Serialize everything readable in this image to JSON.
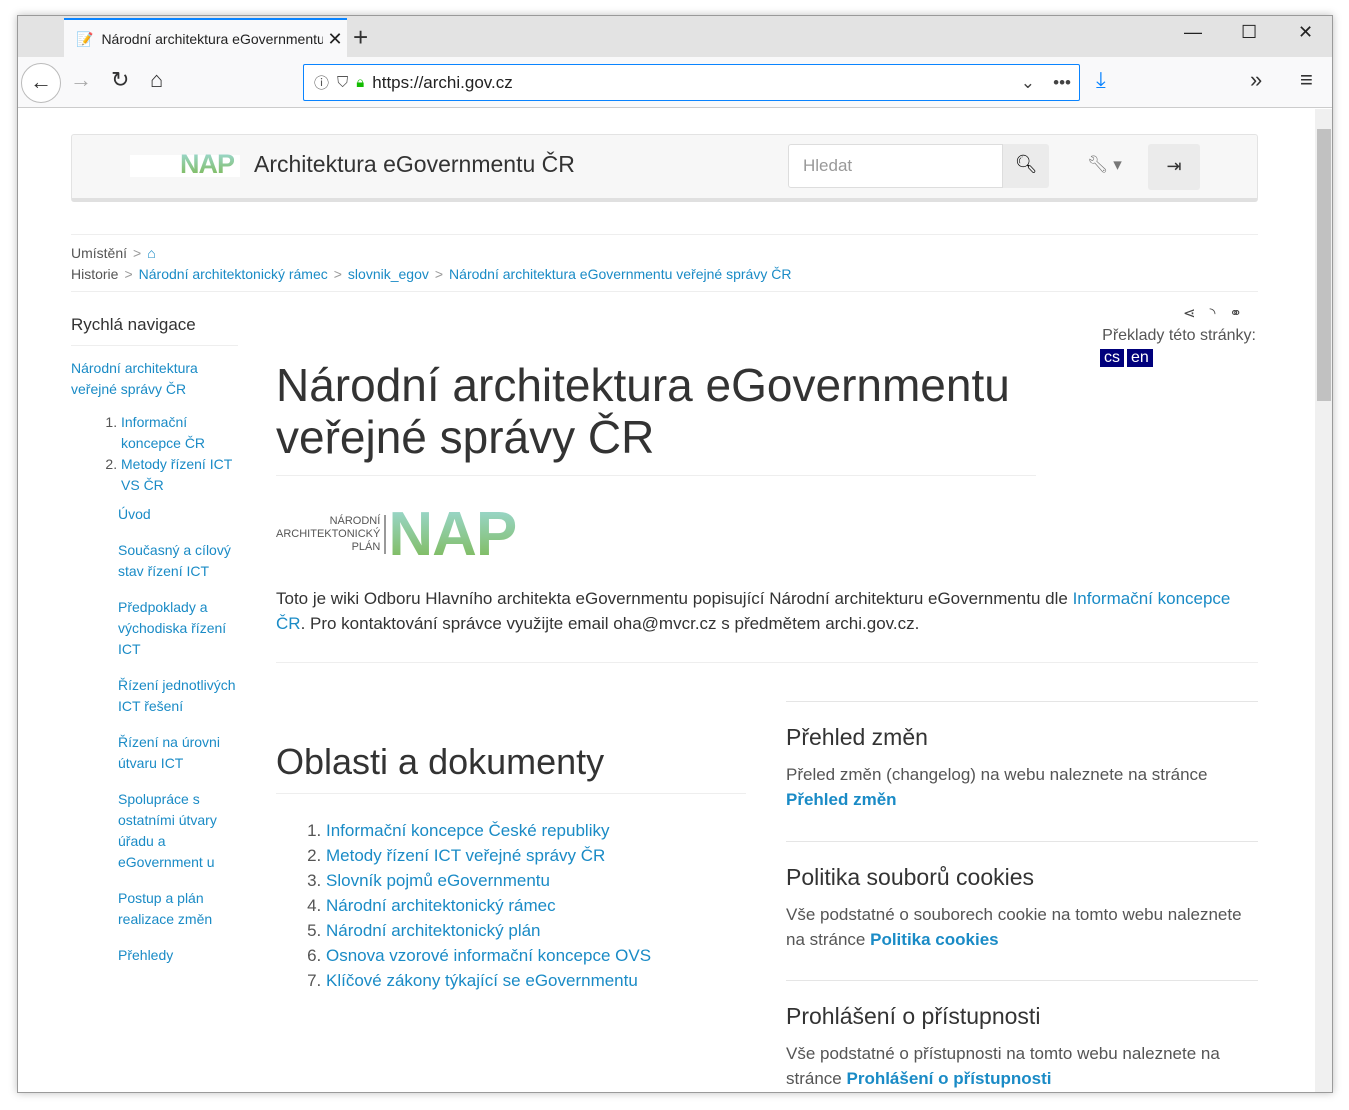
{
  "browser": {
    "tab_title": "Národní architektura eGovernmentu veřejné správy ČR",
    "url": "https://archi.gov.cz"
  },
  "header": {
    "logo_small": "NÁRODNÍ ARCHITEKTONICKÝ PLÁN",
    "logo_nap": "NAP",
    "brand": "Architektura eGovernmentu ČR",
    "search_placeholder": "Hledat"
  },
  "breadcrumb": {
    "location_label": "Umístění",
    "history_label": "Historie",
    "items": [
      "Národní architektonický rámec",
      "slovnik_egov",
      "Národní architektura eGovernmentu veřejné správy ČR"
    ]
  },
  "sidebar": {
    "title": "Rychlá navigace",
    "top": "Národní architektura veřejné správy ČR",
    "items": [
      "Informační koncepce ČR",
      "Metody řízení ICT VS ČR"
    ],
    "sub": [
      "Úvod",
      "Současný a cílový stav řízení ICT",
      "Předpoklady a východiska řízení ICT",
      "Řízení jednotlivých ICT řešení",
      "Řízení na úrovni útvaru ICT",
      "Spolupráce s ostatními útvary úřadu a eGovernment u",
      "Postup a plán realizace změn",
      "Přehledy"
    ]
  },
  "translations": {
    "label": "Překlady této stránky:",
    "langs": [
      "cs",
      "en"
    ]
  },
  "main": {
    "title": "Národní architektura eGovernmentu veřejné správy ČR",
    "intro_a": "Toto je wiki Odboru Hlavního architekta eGovernmentu popisující Národní architekturu eGovernmentu dle ",
    "intro_link": "Informační koncepce ČR",
    "intro_b": ". Pro kontaktování správce využijte email oha@mvcr.cz s předmětem archi.gov.cz.",
    "areas_title": "Oblasti a dokumenty",
    "areas": [
      "Informační koncepce České republiky",
      "Metody řízení ICT veřejné správy ČR",
      "Slovník pojmů eGovernmentu",
      "Národní architektonický rámec",
      "Národní architektonický plán",
      "Osnova vzorové informační koncepce OVS",
      "Klíčové zákony týkající se eGovernmentu"
    ]
  },
  "boxes": [
    {
      "title": "Přehled změn",
      "text": "Přeled změn (changelog) na webu naleznete na stránce ",
      "link": "Přehled změn"
    },
    {
      "title": "Politika souborů cookies",
      "text": "Vše podstatné o souborech cookie na tomto webu naleznete na stránce ",
      "link": "Politika cookies"
    },
    {
      "title": "Prohlášení o přístupnosti",
      "text": "Vše podstatné o přístupnosti na tomto webu naleznete na stránce ",
      "link": "Prohlášení o přístupnosti"
    }
  ]
}
